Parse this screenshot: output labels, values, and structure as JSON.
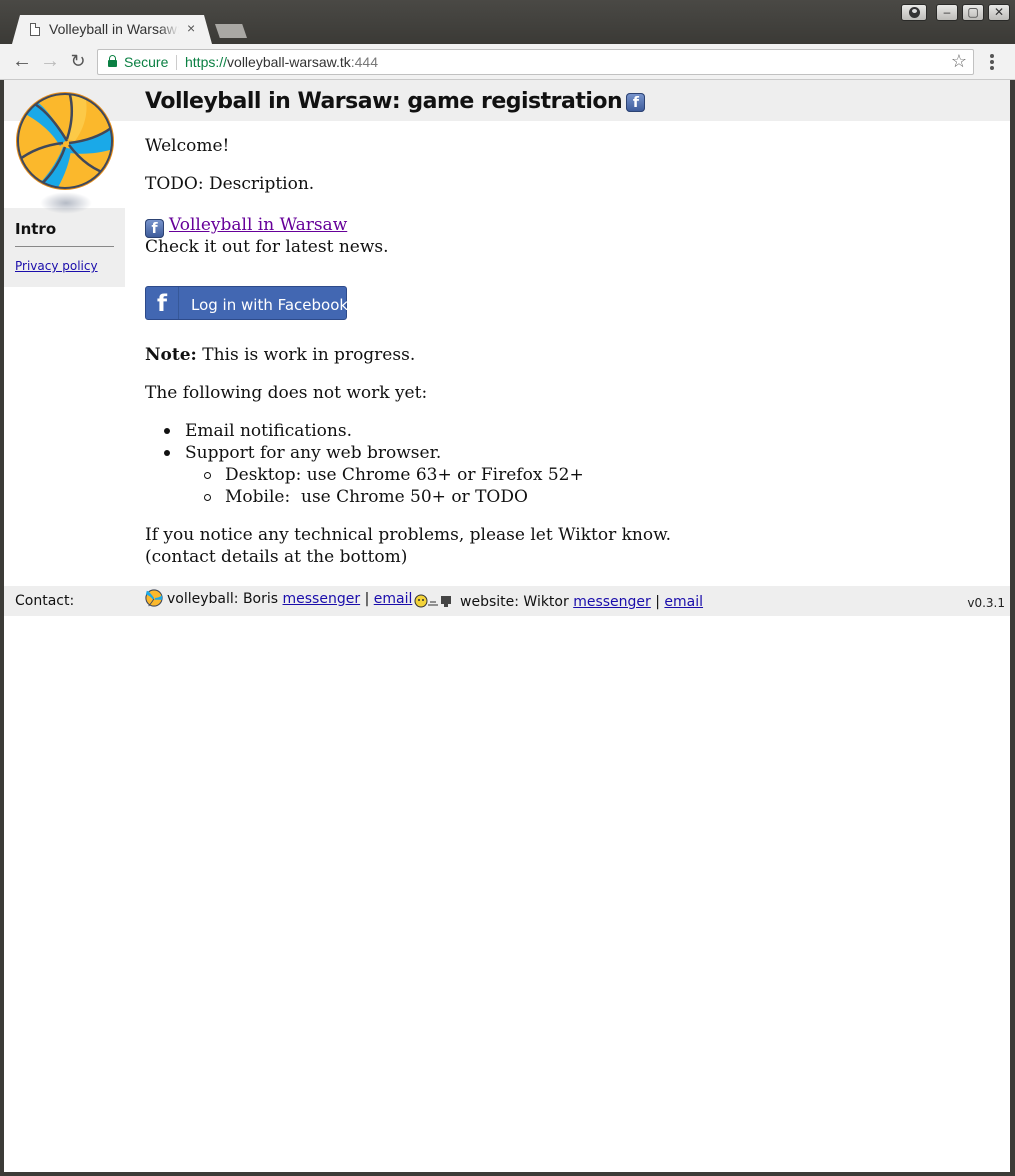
{
  "browser": {
    "tab_title": "Volleyball in Warsaw: game registration",
    "tab_close": "×",
    "secure_label": "Secure",
    "url_scheme": "https://",
    "url_host": "volleyball-warsaw.tk",
    "url_port": ":444",
    "window_buttons": {
      "minimize": "–",
      "maximize": "▢",
      "close": "✕"
    },
    "nav": {
      "back": "←",
      "forward": "→",
      "reload": "↻",
      "bookmark": "☆"
    }
  },
  "header": {
    "title": "Volleyball in Warsaw: game registration",
    "fb_badge": "f"
  },
  "sidebar": {
    "intro": "Intro",
    "privacy_policy": "Privacy policy"
  },
  "main": {
    "welcome": "Welcome!",
    "description": "TODO: Description.",
    "fb_page_icon": "f",
    "fb_page_link": "Volleyball in Warsaw",
    "check_it_out": "Check it out for latest news.",
    "login_button_icon": "f",
    "login_button": "Log in with Facebook",
    "note_label": "Note:",
    "note_text": " This is work in progress.",
    "following": "The following does not work yet:",
    "todo_list": [
      "Email notifications.",
      "Support for any web browser."
    ],
    "browser_list": [
      "Desktop: use Chrome 63+ or Firefox 52+",
      "Mobile:  use Chrome 50+ or TODO"
    ],
    "notice": "If you notice any technical problems, please let Wiktor know.",
    "contact_details": "(contact details at the bottom)"
  },
  "footer": {
    "contact_label": "Contact:",
    "volleyball_label": "volleyball: Boris",
    "website_label": "website: Wiktor",
    "messenger": "messenger",
    "email": "email",
    "separator": "|",
    "version": "v0.3.1"
  },
  "colors": {
    "facebook_blue": "#4267b2",
    "link_blue": "#1a0dab",
    "visited_link": "#660099",
    "secure_green": "#0b8043",
    "band_gray": "#eeeeee",
    "ball_yellow": "#fbb82c",
    "ball_blue": "#1aa9e8"
  }
}
